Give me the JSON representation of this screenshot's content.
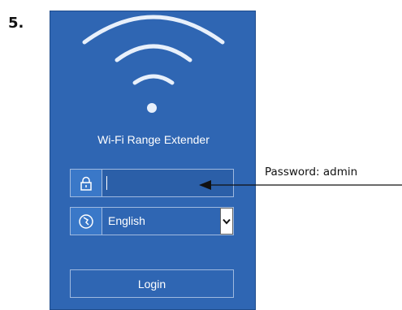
{
  "step": {
    "number": "5."
  },
  "screen": {
    "title": "Wi-Fi Range Extender",
    "icons": {
      "wifi": "wifi-signal-icon",
      "password": "lock-icon",
      "language": "globe-icon",
      "dropdown": "chevron-down-icon"
    },
    "password_field": {
      "value": "",
      "placeholder": ""
    },
    "language_select": {
      "selected": "English"
    },
    "login_button": {
      "label": "Login"
    }
  },
  "annotation": {
    "text": "Password: admin"
  },
  "colors": {
    "panel": "#2f66b3",
    "field_border": "#9fb9df",
    "icon_box": "#3a78c8",
    "text": "#ffffff"
  }
}
